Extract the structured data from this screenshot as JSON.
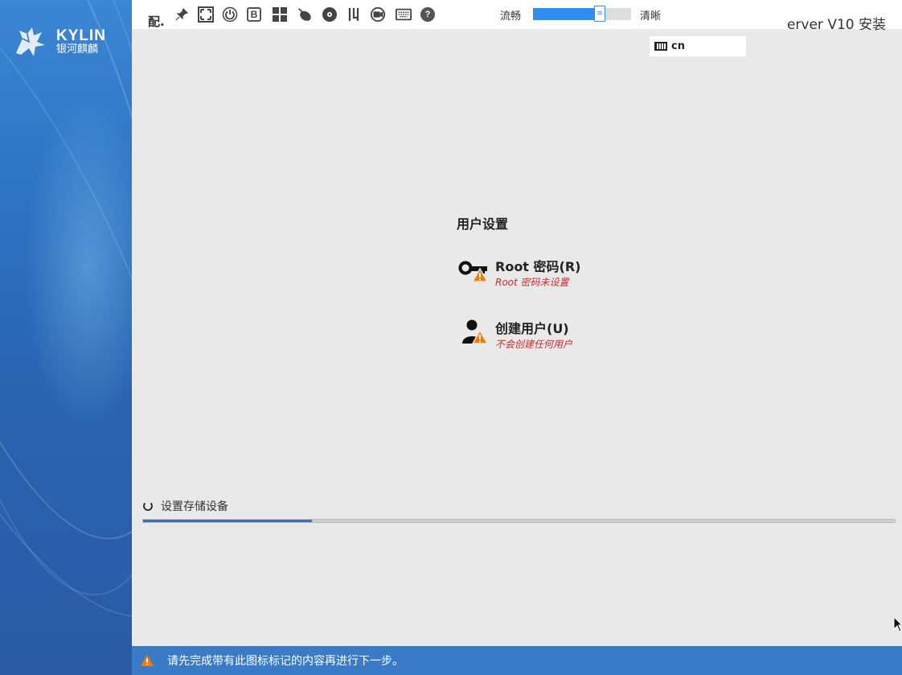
{
  "brand": {
    "logo_text": "KYLIN",
    "logo_sub": "银河麒麟"
  },
  "toolbar": {
    "left_title": "配.",
    "quality_left": "流畅",
    "quality_right": "清晰",
    "quality_level": 0.68,
    "icons": [
      "pin-icon",
      "fullscreen-icon",
      "power-icon",
      "b-icon",
      "ctrl-alt-del-icon",
      "mouse-icon",
      "disc-icon",
      "usb-icon",
      "record-icon",
      "keyboard-icon",
      "help-icon"
    ],
    "b_label": "B",
    "help_label": "?",
    "title_right": "erver V10 安装"
  },
  "keyboard_layout": {
    "value": "cn"
  },
  "main": {
    "section_title": "用户设置",
    "spokes": [
      {
        "title": "Root 密码(R)",
        "status": "Root 密码未设置",
        "icon": "key-warning-icon"
      },
      {
        "title": "创建用户(U)",
        "status": "不会创建任何用户",
        "icon": "user-warning-icon"
      }
    ]
  },
  "progress": {
    "label": "设置存储设备",
    "fraction": 0.225
  },
  "warning_bar": {
    "text": "请先完成带有此图标标记的内容再进行下一步。"
  },
  "colors": {
    "sidebar": "#2c6fbf",
    "accent": "#2f8df0",
    "warning": "#f57900",
    "error_text": "#cc2a2a",
    "warnbar": "#3a7bc8"
  }
}
